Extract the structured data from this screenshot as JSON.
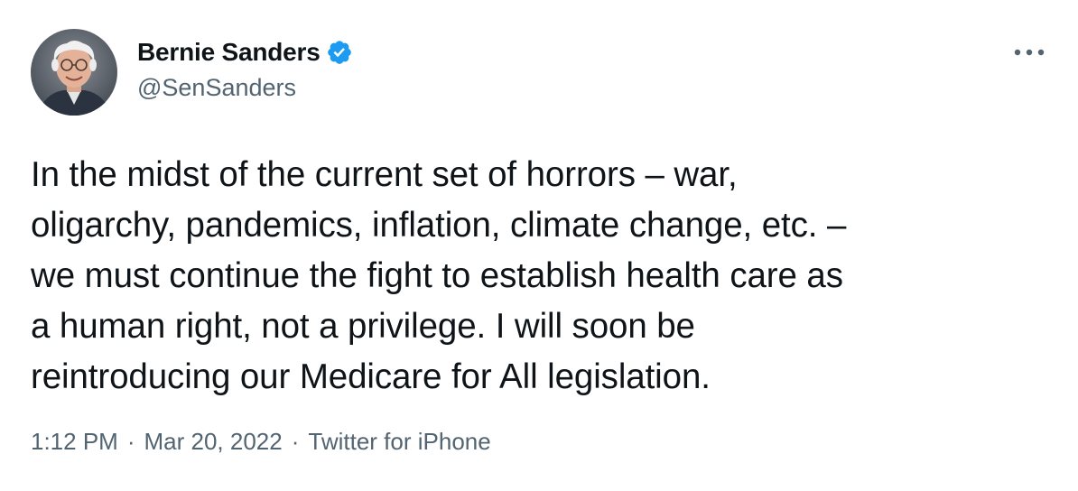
{
  "author": {
    "display_name": "Bernie Sanders",
    "handle": "@SenSanders",
    "verified": true,
    "verified_color": "#1d9bf0"
  },
  "more_icon": "more-horizontal-icon",
  "tweet": {
    "text": "In the midst of the current set of horrors – war,\noligarchy, pandemics, inflation, climate change, etc. –\nwe must continue the fight to establish health care as\na human right, not a privilege. I will soon be\nreintroducing our Medicare for All legislation."
  },
  "meta": {
    "time": "1:12 PM",
    "separator": "·",
    "date": "Mar 20, 2022",
    "source": "Twitter for iPhone"
  },
  "colors": {
    "text": "#0f1419",
    "secondary": "#536471",
    "accent": "#1d9bf0"
  }
}
